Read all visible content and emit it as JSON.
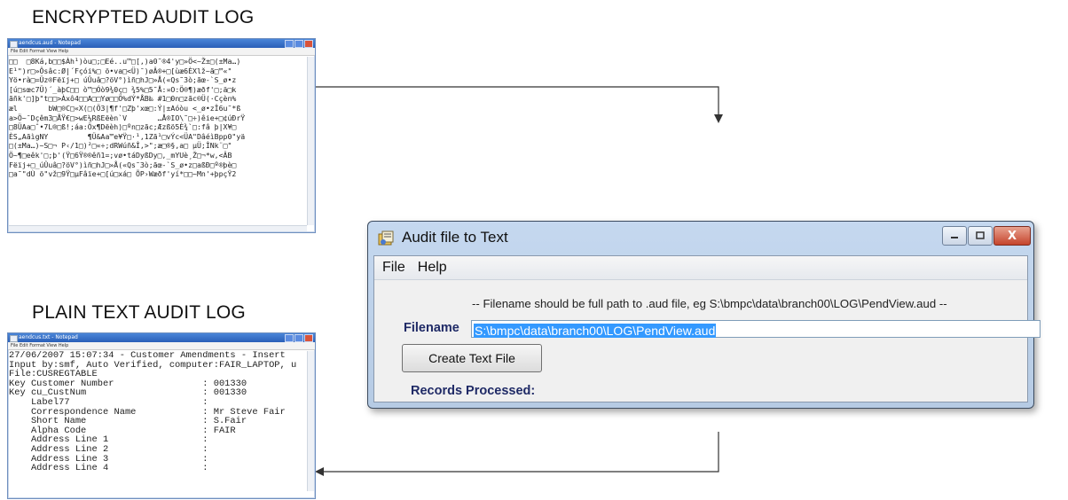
{
  "captions": {
    "encrypted": "ENCRYPTED AUDIT LOG",
    "plain": "PLAIN TEXT AUDIT LOG"
  },
  "encrypted_window": {
    "title": "aendcus.aud - Notepad",
    "menu": "File  Edit  Format  View  Help",
    "lines": [
      "□□  □8Ká‚b□□$Àh¹)òu□;□Eé..u™□[‚)a0˜®4'y□»Ö<~Ž±□(±Ma…)",
      "E¹\")r□»Ôsâc:Ø|´Fçói%□ ö•va□<Ü)¯)øÂ®+□[ùæ6ÈXlž~ã□™«\"",
      "Yö•rà□=Üz®Fëïj+□ úÛuâ□?öV°)ìñ□hJ□»Å(«Qs˜3ò;ãœ-`S_ø•z",
      "[ú□sœc7Ü)´_àþC□□ ò™□Óò9¾0ç□ ¾5%□5˜Å:¤O:Ö®¶)æðf'□;ä□k",
      "ãñk'□]þ\"t□□>Àxô4□□A□□Yø□□Ö%dÝ*ÅB‰ #1□0n□zãc®Ü(·Cçèn%",
      "æl       bW□®C□«X(□(Ö3|¶f'□Zþ'xœ□:Ý|±Aóòu <_ø•zÎ6u˜*ß",
      "a>Ö~¯Dçêm3□ÅŸ€□>wE¼RßEëèn`V       …Å®IO\\˜□÷)êie+□¢úÐrŸ",
      "□8ÜAa□ˆ•7L®□ß!;áa:Öx¶Dëèh)□ºn□zãc;Æzßö5È¾`□:fâ þ|X¥□",
      "ÈS„AãìgNY         ¶Ü&Aa™e¥Ÿ□·¹,1Zã¹□vÝc<ÜA\"DâéìBpp0\"yä",
      "□(±Ma…)~S□¬ P‹/1□)²□«÷;dRWúñ&Î,>\";æ□®§,a□ µÜ;ÎNk¨□\"",
      "Ö~¶□eêk'□;þ'(Ÿ□6Ÿ®®êñ1=;vø•táDyßDy□,_mYUè¸Ž□¬*w,<ÂB",
      "Fëïj+□_úÛuâ□?öV°)ìñ□hJ□»Å(«Qs˜3ò;ãœ-`S_ø•z□aßÐ□º®þè□",
      "□a˜\"dÙ ö\"vž□9Ÿ□µFâïe+□[ú□xá□ ÕP›Wæðf'yí*□□~Mn'+þpçŸ2"
    ]
  },
  "plain_window": {
    "title": "aendcus.txt - Notepad",
    "menu": "File  Edit  Format  View  Help",
    "lines": [
      "27/06/2007 15:07:34 - Customer Amendments - Insert",
      "Input by:smf, Auto Verified, computer:FAIR_LAPTOP, u",
      "File:CUSREGTABLE",
      "Key Customer Number                : 001330",
      "Key cu_CustNum                     : 001330",
      "    Label77                        :",
      "    Correspondence Name            : Mr Steve Fair",
      "    Short Name                     : S.Fair",
      "    Alpha Code                     : FAIR",
      "    Address Line 1                 :",
      "    Address Line 2                 :",
      "    Address Line 3                 :",
      "    Address Line 4                 :"
    ]
  },
  "dialog": {
    "title": "Audit file to Text",
    "menu": [
      "File",
      "Help"
    ],
    "hint": "-- Filename should be full path to .aud file, eg S:\\bmpc\\data\\branch00\\LOG\\PendView.aud --",
    "filename_label": "Filename",
    "filename_value": "S:\\bmpc\\data\\branch00\\LOG\\PendView.aud",
    "create_button": "Create Text File",
    "records_label": "Records Processed:",
    "close_glyph": "X"
  }
}
